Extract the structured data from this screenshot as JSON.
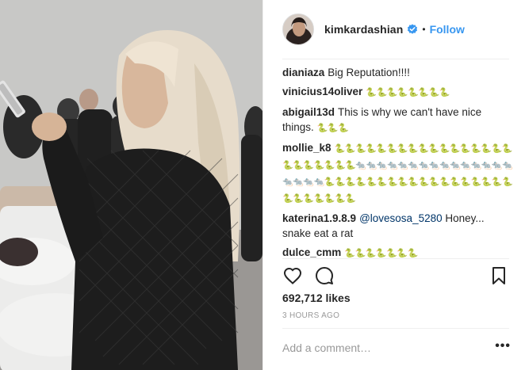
{
  "post": {
    "username": "kimkardashian",
    "separator": "•",
    "follow_label": "Follow",
    "likes": "692,712 likes",
    "time": "3 HOURS AGO",
    "add_comment_placeholder": "Add a comment…",
    "more_label": "•••"
  },
  "comments": [
    {
      "user": "dianiaza",
      "text": "Big Reputation!!!!",
      "emoji": ""
    },
    {
      "user": "vinicius14oliver",
      "text": "",
      "emoji": "🐍🐍🐍🐍🐍🐍🐍🐍"
    },
    {
      "user": "abigail13d",
      "text": "This is why we can't have nice things.",
      "emoji": "🐍🐍🐍"
    },
    {
      "user": "mollie_k8",
      "text": "",
      "emoji": "🐍🐍🐍🐍🐍🐍🐍🐍🐍🐍🐍🐍🐍🐍🐍🐍🐍🐍🐍🐍🐍🐍🐍🐍🐀🐀🐀🐀🐀🐀🐀🐀🐀🐀🐀🐀🐀🐀🐀🐀🐀🐀🐀🐍🐍🐍🐍🐍🐍🐍🐍🐍🐍🐍🐍🐍🐍🐍🐍🐍🐍🐍🐍🐍🐍🐍🐍🐍"
    },
    {
      "user": "katerina1.9.8.9",
      "mention": "@lovesosa_5280",
      "text": "Honey... snake eat a rat",
      "emoji": ""
    },
    {
      "user": "dulce_cmm",
      "text": "",
      "emoji": "🐍🐍🐍🐍🐍🐍🐍"
    }
  ],
  "icons": {
    "verified": "verified-badge-icon",
    "like": "heart-outline-icon",
    "comment": "speech-bubble-icon",
    "save": "bookmark-icon"
  },
  "colors": {
    "accent": "#3897f0",
    "text": "#262626",
    "muted": "#999999",
    "divider": "#efefef",
    "mention": "#003569"
  }
}
